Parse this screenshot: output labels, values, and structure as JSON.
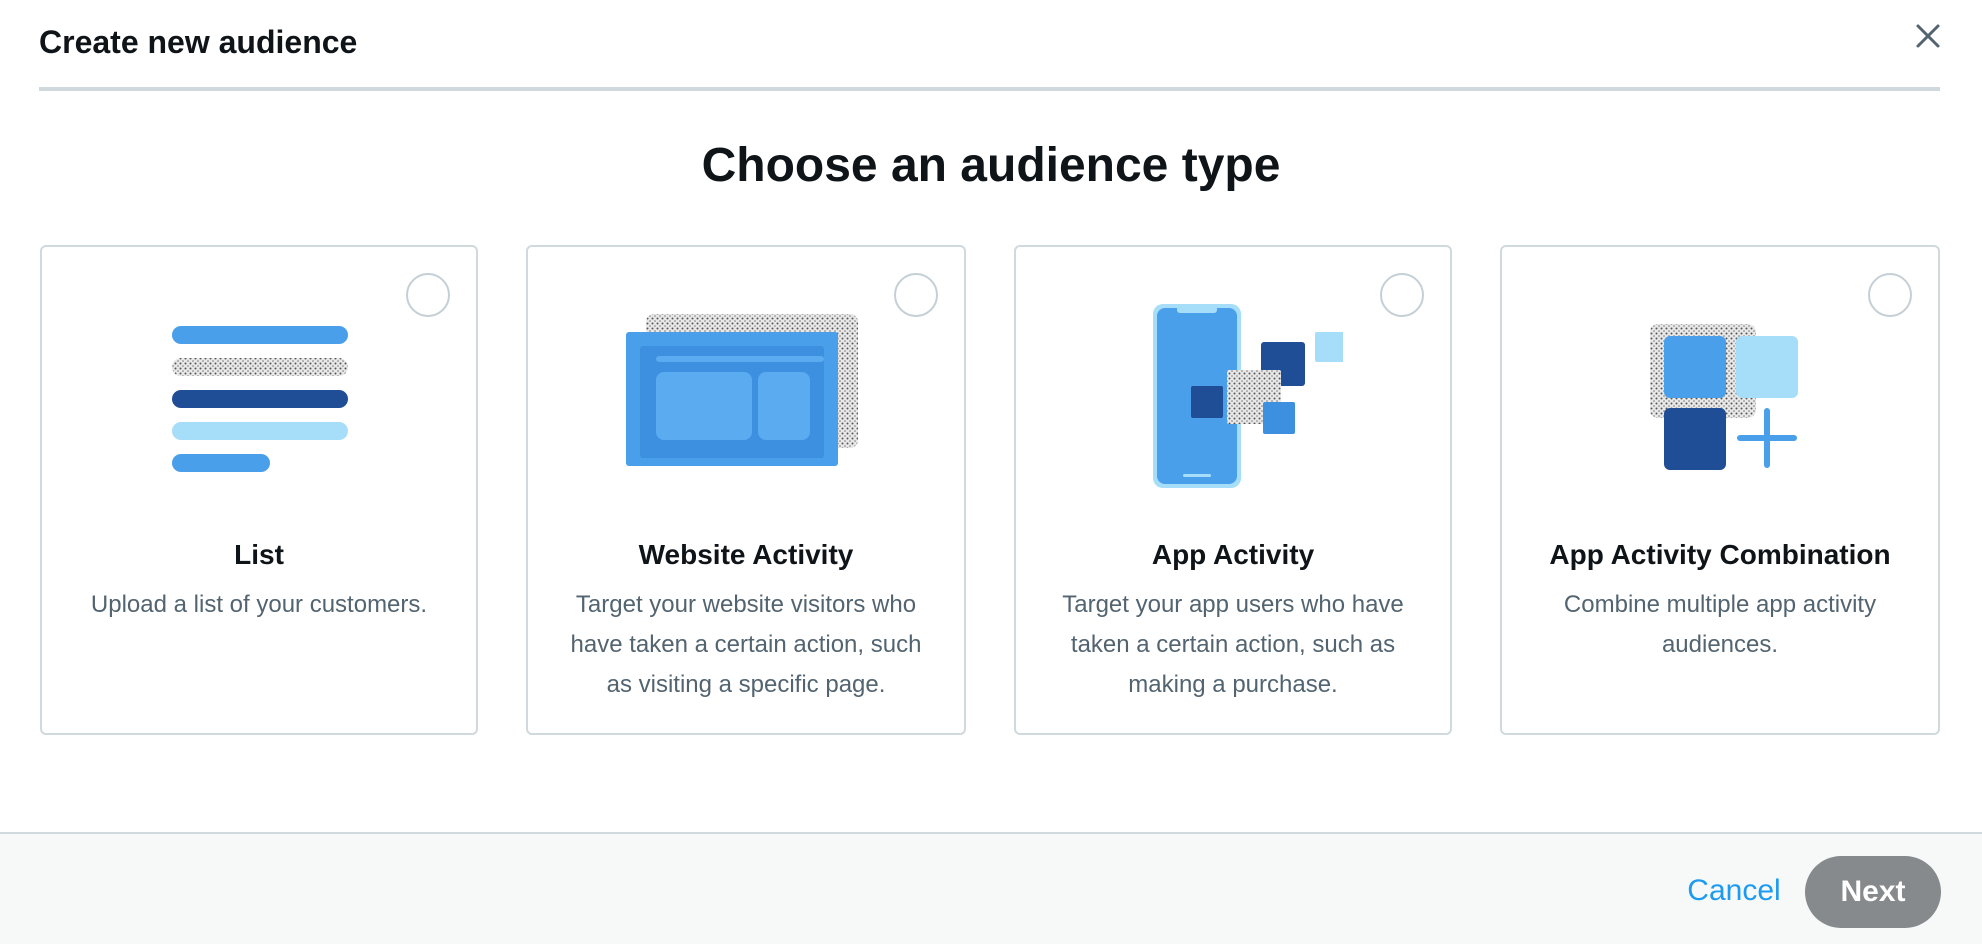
{
  "header": {
    "title": "Create new audience",
    "close_icon": "close-icon"
  },
  "main": {
    "heading": "Choose an audience type",
    "cards": [
      {
        "title": "List",
        "description": "Upload a list of your customers.",
        "icon": "list-illustration-icon",
        "selected": false
      },
      {
        "title": "Website Activity",
        "description": "Target your website visitors who have taken a certain action, such as visiting a specific page.",
        "icon": "website-illustration-icon",
        "selected": false
      },
      {
        "title": "App Activity",
        "description": "Target your app users who have taken a certain action, such as making a purchase.",
        "icon": "mobile-app-illustration-icon",
        "selected": false
      },
      {
        "title": "App Activity Combination",
        "description": "Combine multiple app activity audiences.",
        "icon": "app-combination-illustration-icon",
        "selected": false
      }
    ]
  },
  "footer": {
    "cancel_label": "Cancel",
    "next_label": "Next"
  },
  "colors": {
    "accent": "#1d9bf0",
    "blue_mid": "#4a9fea",
    "blue_dark": "#1f4e96",
    "blue_light": "#a6defa",
    "disabled_button": "#878a8c"
  }
}
